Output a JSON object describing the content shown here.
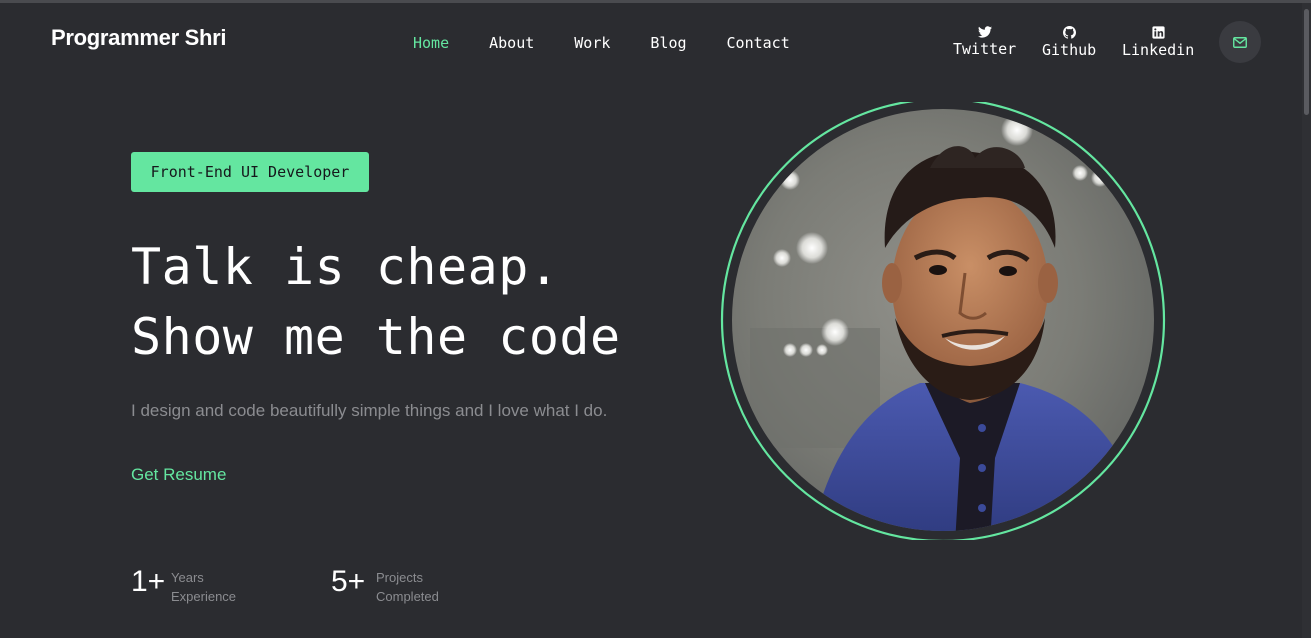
{
  "header": {
    "logo": "Programmer Shri",
    "nav": [
      "Home",
      "About",
      "Work",
      "Blog",
      "Contact"
    ],
    "active_nav": "Home",
    "social": [
      {
        "label": "Twitter",
        "icon": "twitter-icon"
      },
      {
        "label": "Github",
        "icon": "github-icon"
      },
      {
        "label": "Linkedin",
        "icon": "linkedin-icon"
      }
    ],
    "mail_icon": "mail-icon"
  },
  "hero": {
    "badge": "Front-End UI Developer",
    "headline_line1": "Talk is cheap.",
    "headline_line2": "Show me the code",
    "tagline": "I design and code beautifully simple things and I love what I do.",
    "cta": "Get Resume",
    "stats": [
      {
        "value": "1+",
        "label_line1": "Years",
        "label_line2": "Experience"
      },
      {
        "value": "5+",
        "label_line1": "Projects",
        "label_line2": "Completed"
      }
    ]
  },
  "colors": {
    "background": "#2b2c30",
    "accent": "#64e6a0",
    "muted": "#8b8c90"
  }
}
